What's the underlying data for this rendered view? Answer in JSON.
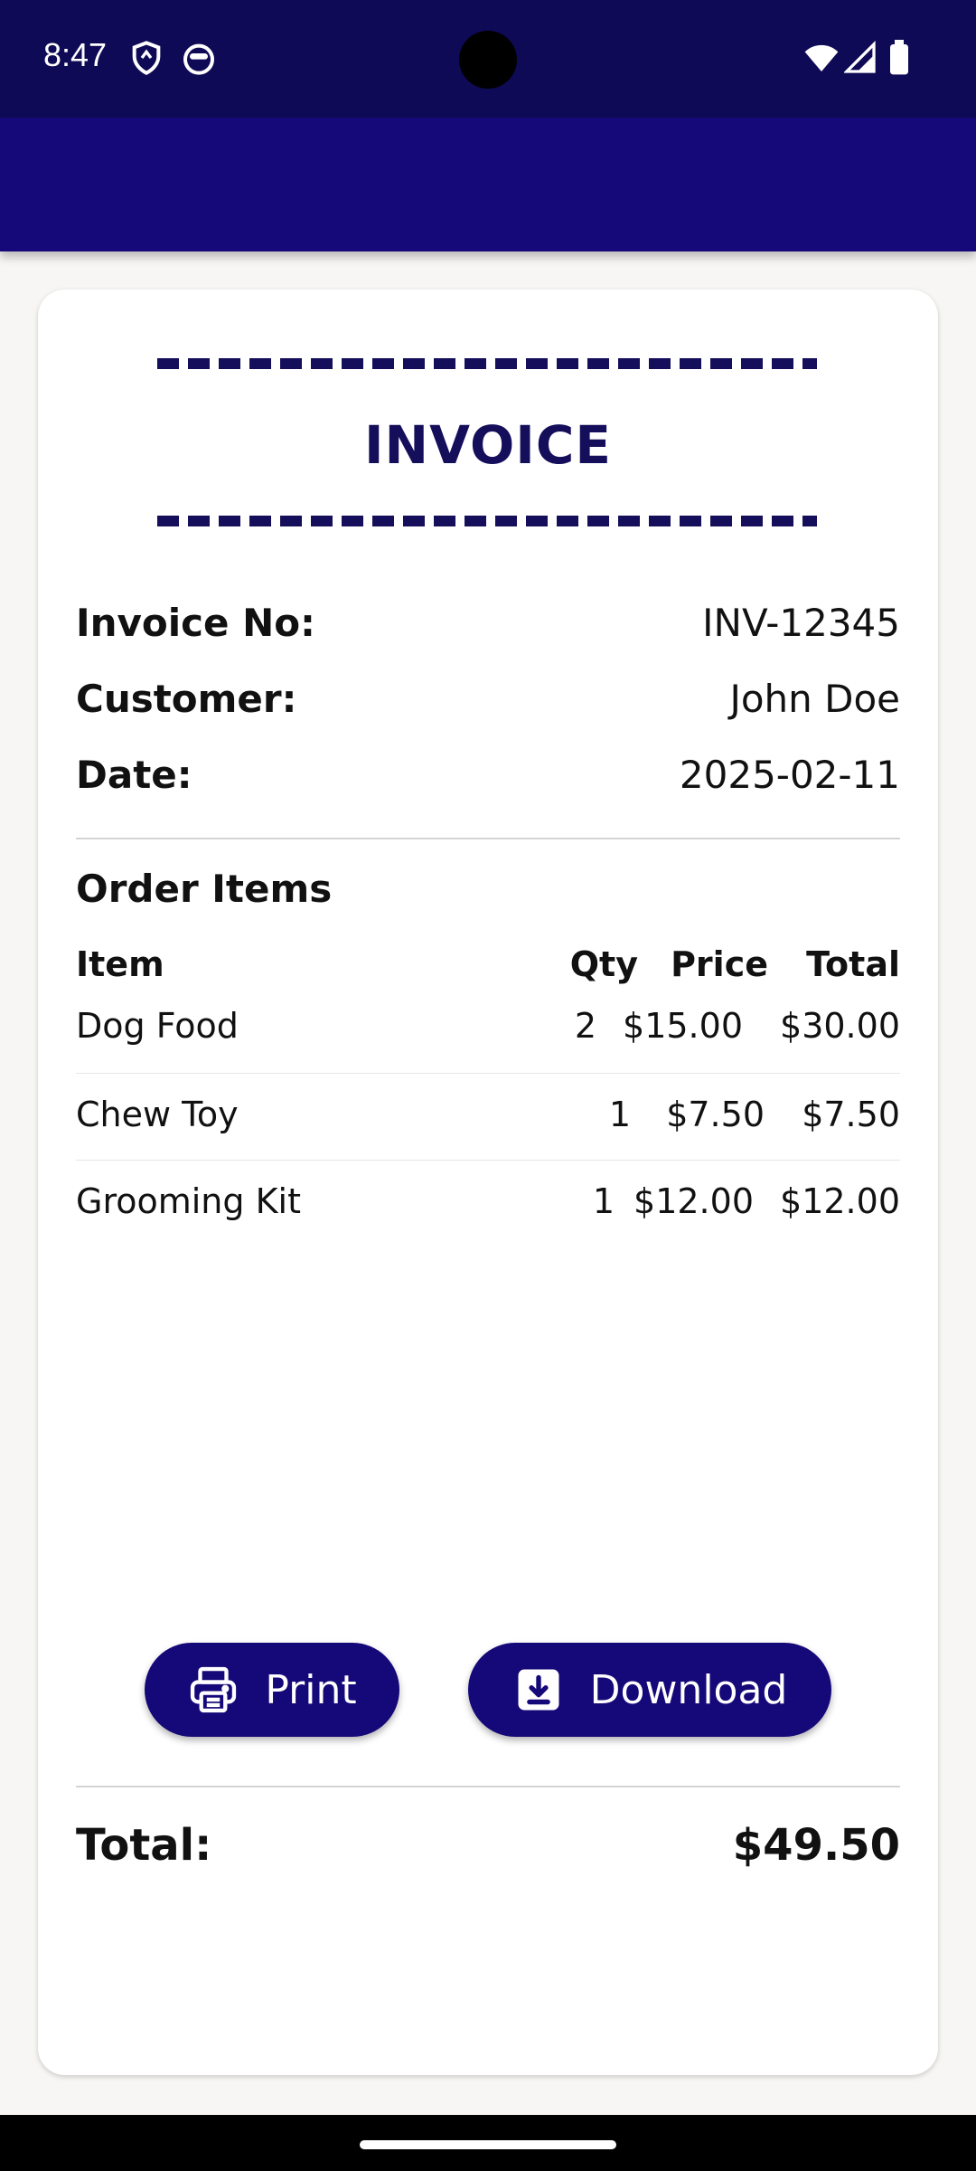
{
  "status_bar": {
    "time": "8:47"
  },
  "invoice": {
    "title": "INVOICE",
    "fields": [
      {
        "label": "Invoice No:",
        "value": "INV-12345"
      },
      {
        "label": "Customer:",
        "value": "John Doe"
      },
      {
        "label": "Date:",
        "value": "2025-02-11"
      }
    ],
    "order_items_title": "Order Items",
    "columns": {
      "item": "Item",
      "qty": "Qty",
      "price": "Price",
      "total": "Total"
    },
    "items": [
      {
        "item": "Dog Food",
        "qty": "2",
        "price": "$15.00",
        "total": "$30.00"
      },
      {
        "item": "Chew Toy",
        "qty": "1",
        "price": "$7.50",
        "total": "$7.50"
      },
      {
        "item": "Grooming Kit",
        "qty": "1",
        "price": "$12.00",
        "total": "$12.00"
      }
    ],
    "total_label": "Total:",
    "total_value": "$49.50"
  },
  "actions": {
    "print_label": "Print",
    "download_label": "Download"
  },
  "colors": {
    "primary": "#150878",
    "status_bar": "#0f0a55",
    "title": "#150e5a"
  },
  "icons": [
    "shield-icon",
    "face-icon",
    "wifi-icon",
    "signal-icon",
    "battery-icon",
    "printer-icon",
    "download-icon"
  ]
}
